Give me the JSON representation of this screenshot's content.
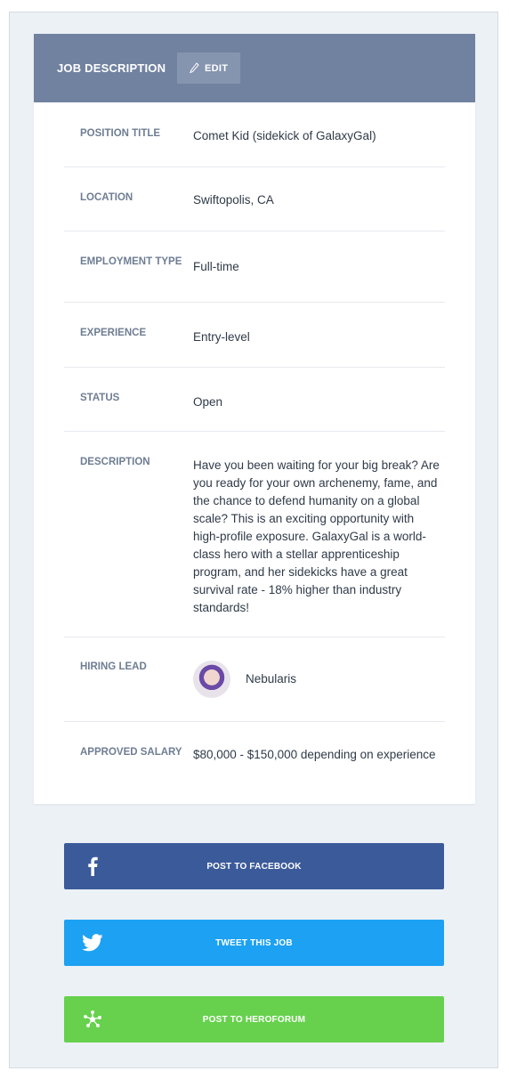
{
  "card": {
    "title": "JOB DESCRIPTION",
    "edit_label": "EDIT"
  },
  "fields": {
    "position_title": {
      "label": "POSITION TITLE",
      "value": "Comet Kid (sidekick of GalaxyGal)"
    },
    "location": {
      "label": "LOCATION",
      "value": "Swiftopolis, CA"
    },
    "employment_type": {
      "label": "EMPLOYMENT TYPE",
      "value": "Full-time"
    },
    "experience": {
      "label": "EXPERIENCE",
      "value": "Entry-level"
    },
    "status": {
      "label": "STATUS",
      "value": "Open"
    },
    "description": {
      "label": "DESCRIPTION",
      "value": "Have you been waiting for your big break? Are you ready for your own archenemy, fame, and the chance to defend humanity on a global scale? This is an exciting opportunity with high-profile exposure. GalaxyGal is a world-class hero with a stellar apprenticeship program, and her sidekicks have a great survival rate - 18% higher than industry standards!"
    },
    "hiring_lead": {
      "label": "HIRING LEAD",
      "value": "Nebularis"
    },
    "approved_salary": {
      "label": "APPROVED SALARY",
      "value": "$80,000 - $150,000 depending on experience"
    }
  },
  "share": {
    "facebook_label": "POST TO FACEBOOK",
    "twitter_label": "TWEET THIS JOB",
    "heroforum_label": "POST TO HEROFORUM"
  },
  "colors": {
    "header": "#7182a0",
    "facebook": "#3b5a9a",
    "twitter": "#1da1f2",
    "heroforum": "#67d14e"
  },
  "icons": [
    "pencil-icon",
    "facebook-icon",
    "twitter-icon",
    "heroforum-icon"
  ]
}
